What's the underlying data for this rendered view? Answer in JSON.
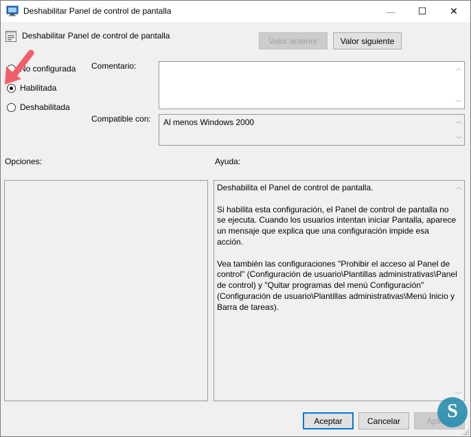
{
  "window": {
    "title": "Deshabilitar Panel de control de pantalla",
    "controls": {
      "minimize": "—",
      "maximize": "☐",
      "close": "✕"
    }
  },
  "header": {
    "policy_name": "Deshabilitar Panel de control de pantalla",
    "prev_button": "Valor anterior",
    "next_button": "Valor siguiente"
  },
  "state": {
    "options": [
      {
        "label": "No configurada",
        "checked": false
      },
      {
        "label": "Habilitada",
        "checked": true
      },
      {
        "label": "Deshabilitada",
        "checked": false
      }
    ]
  },
  "comment": {
    "label": "Comentario:",
    "value": ""
  },
  "supported": {
    "label": "Compatible con:",
    "value": "Al menos Windows 2000"
  },
  "options_panel": {
    "label": "Opciones:"
  },
  "help_panel": {
    "label": "Ayuda:",
    "text": "Deshabilita el Panel de control de pantalla.\n\nSi habilita esta configuración, el Panel de control de pantalla no se ejecuta. Cuando los usuarios intentan iniciar Pantalla, aparece un mensaje que explica que una configuración impide esa acción.\n\nVea también las configuraciones \"Prohibir el acceso al Panel de control\" (Configuración de usuario\\Plantillas administrativas\\Panel de control) y \"Quitar programas del menú Configuración\" (Configuración de usuario\\Plantillas administrativas\\Menú Inicio y Barra de tareas)."
  },
  "footer": {
    "accept": "Aceptar",
    "cancel": "Cancelar",
    "apply": "Aplicar"
  },
  "colors": {
    "accent": "#0078d7",
    "arrow_annotation": "#f0606a"
  }
}
